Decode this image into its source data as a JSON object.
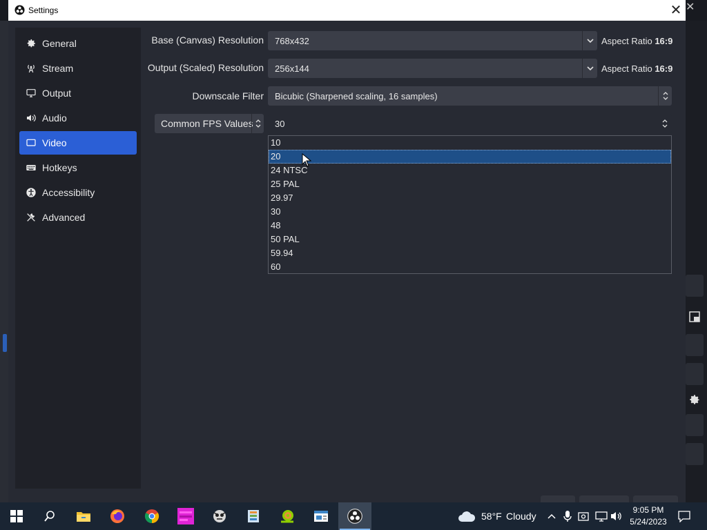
{
  "dialog": {
    "title": "Settings",
    "close_glyph": "✕"
  },
  "sidebar": {
    "items": [
      {
        "label": "General",
        "icon": "gear-icon"
      },
      {
        "label": "Stream",
        "icon": "antenna-icon"
      },
      {
        "label": "Output",
        "icon": "output-monitor-icon"
      },
      {
        "label": "Audio",
        "icon": "speaker-icon"
      },
      {
        "label": "Video",
        "icon": "display-icon",
        "active": true
      },
      {
        "label": "Hotkeys",
        "icon": "keyboard-icon"
      },
      {
        "label": "Accessibility",
        "icon": "accessibility-icon"
      },
      {
        "label": "Advanced",
        "icon": "tools-icon"
      }
    ]
  },
  "video": {
    "base_label": "Base (Canvas) Resolution",
    "base_value": "768x432",
    "base_aspect_prefix": "Aspect Ratio",
    "base_aspect_value": "16:9",
    "output_label": "Output (Scaled) Resolution",
    "output_value": "256x144",
    "output_aspect_prefix": "Aspect Ratio",
    "output_aspect_value": "16:9",
    "downscale_label": "Downscale Filter",
    "downscale_value": "Bicubic (Sharpened scaling, 16 samples)",
    "fps_type": "Common FPS Values",
    "fps_value": "30"
  },
  "fps_dropdown": {
    "options": [
      "10",
      "20",
      "24 NTSC",
      "25 PAL",
      "29.97",
      "30",
      "48",
      "50 PAL",
      "59.94",
      "60"
    ],
    "highlighted": "20"
  },
  "taskbar": {
    "apps": [
      "windows-start-icon",
      "search-icon",
      "file-explorer-icon",
      "firefox-icon",
      "chrome-icon",
      "magenta-app-icon",
      "obs-face-icon",
      "archive-app-icon",
      "snail-app-icon",
      "window-app-icon",
      "obs-studio-icon"
    ],
    "weather_temp": "58°F",
    "weather_desc": "Cloudy",
    "time": "9:05 PM",
    "date": "5/24/2023"
  },
  "colors": {
    "accent": "#2b5fd6",
    "highlight": "#1e4f88",
    "taskbar": "#1a2533"
  }
}
